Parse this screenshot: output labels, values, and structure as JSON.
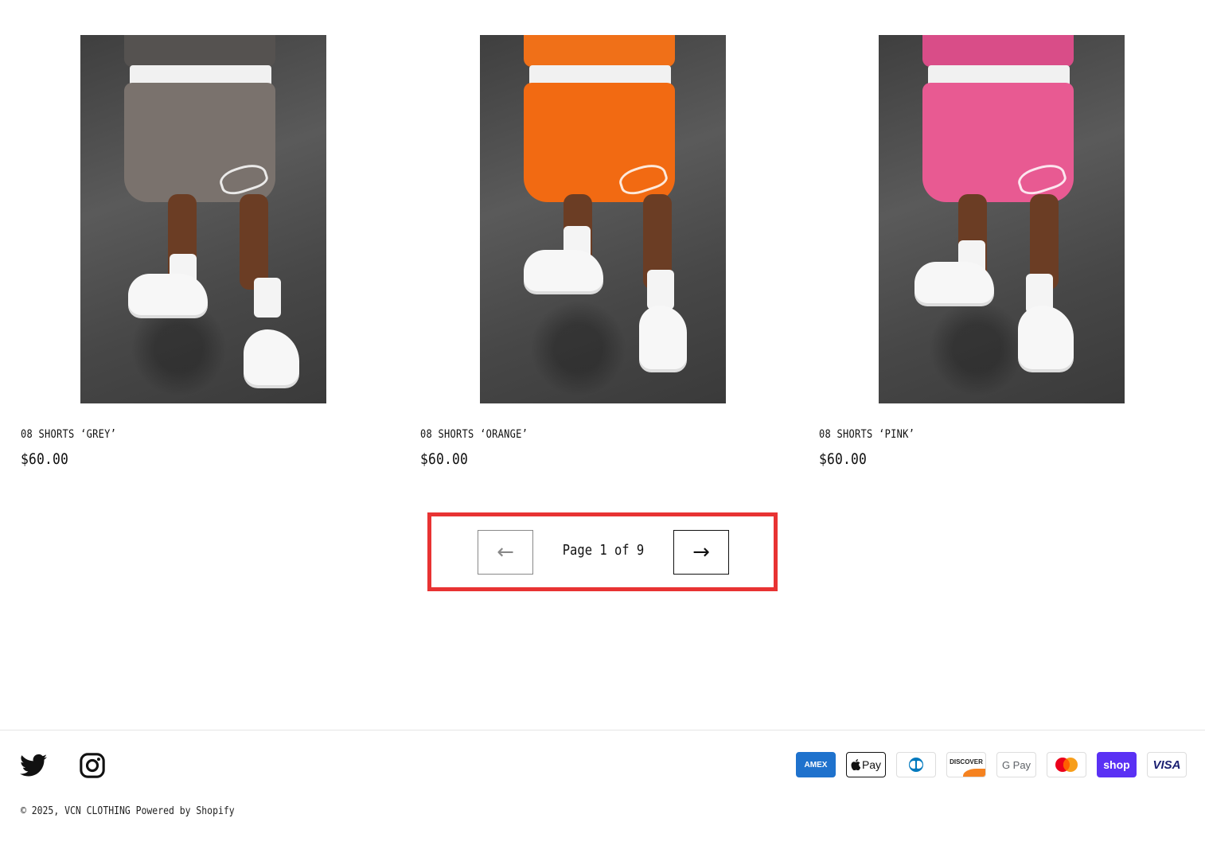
{
  "products": [
    {
      "title": "08 SHORTS ‘GREY’",
      "price": "$60.00",
      "image_alt": "08 Shorts Grey",
      "color": "#7a726d",
      "shirt_color": "#555250"
    },
    {
      "title": "08 SHORTS ‘ORANGE’",
      "price": "$60.00",
      "image_alt": "08 Shorts Orange",
      "color": "#f26a12",
      "shirt_color": "#f07018"
    },
    {
      "title": "08 SHORTS ‘PINK’",
      "price": "$60.00",
      "image_alt": "08 Shorts Pink",
      "color": "#e85a92",
      "shirt_color": "#d94d88"
    }
  ],
  "pagination": {
    "text": "Page 1 of 9",
    "prev_icon": "←",
    "next_icon": "→",
    "prev_icon_name": "arrow-left-icon",
    "next_icon_name": "arrow-right-icon"
  },
  "footer": {
    "social": [
      {
        "name": "twitter-icon"
      },
      {
        "name": "instagram-icon"
      }
    ],
    "payments": {
      "amex": "AMEX",
      "applepay": "Pay",
      "discover": "DISCOVER",
      "gpay": "G Pay",
      "shop": "shop",
      "visa": "VISA"
    },
    "copyright_prefix": "© 2025,",
    "store_name": "VCN CLOTHING",
    "powered_by": "Powered by Shopify"
  },
  "colors": {
    "highlight": "#e83333",
    "text": "#111111"
  }
}
